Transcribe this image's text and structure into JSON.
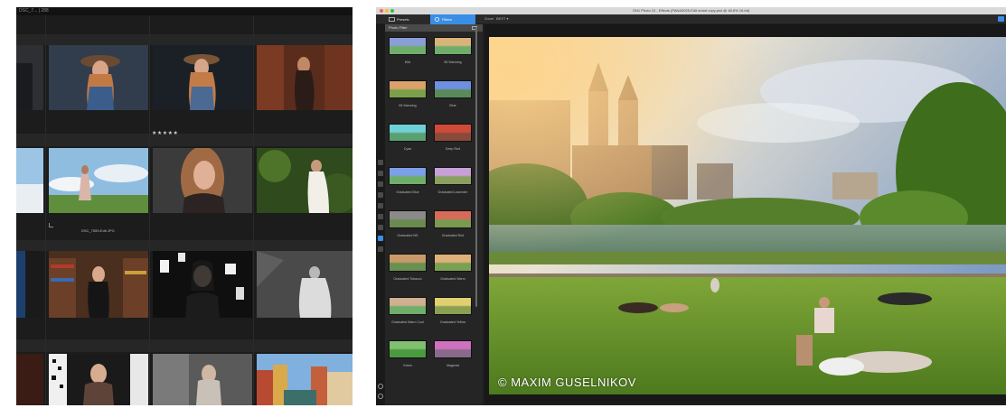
{
  "left_panel": {
    "title": "DSC_7... | 288",
    "rating_stars": "★★★★★",
    "selected_filename": "DSC_7559-Edit.JPG"
  },
  "right_panel": {
    "window_title": "ON1 Photo 10 - Effects (PANA0025-Edit smart copy.psd @ 48.6% 16-bit)",
    "tabs": [
      {
        "label": "Presets",
        "icon": "presets-icon"
      },
      {
        "label": "Filters",
        "icon": "filters-icon"
      }
    ],
    "toolbar": {
      "zoom_label": "Zoom",
      "zoom_value": "BEST ▾"
    },
    "filter_panel_title": "Photo Filter",
    "filters": [
      {
        "label": "80A"
      },
      {
        "label": "85 Warming"
      },
      {
        "label": "85 Warming"
      },
      {
        "label": "Blue"
      },
      {
        "label": "Cyan"
      },
      {
        "label": "Deep Red"
      },
      {
        "label": "Graduated Blue"
      },
      {
        "label": "Graduated Lavender"
      },
      {
        "label": "Graduated ND"
      },
      {
        "label": "Graduated Red"
      },
      {
        "label": "Graduated Tobacco"
      },
      {
        "label": "Graduated Warm"
      },
      {
        "label": "Graduated Warm Cool"
      },
      {
        "label": "Graduated Yellow"
      },
      {
        "label": "Green"
      },
      {
        "label": "Magenta"
      }
    ],
    "watermark": "© MAXIM GUSELNIKOV"
  },
  "colors": {
    "accent": "#3a8ee6",
    "panel_bg": "#1e1e1e",
    "grid_bg": "#1c1c1c"
  }
}
